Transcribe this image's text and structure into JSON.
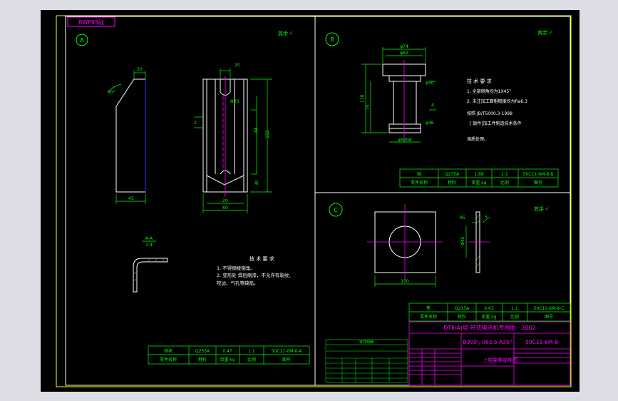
{
  "drawing": {
    "code_box": "8WPII3战",
    "views": [
      "A",
      "B",
      "C"
    ],
    "roughness": "其余 √",
    "view_a": {
      "dim_top": "20",
      "dim_angle": "60°",
      "dim_w1": "20",
      "dim_w2": "20",
      "dim_w3": "60",
      "dim_hole": "Φ25",
      "dim_h1": "88",
      "dim_h2": "30",
      "dim_h3": "152",
      "dim_bottom": "45",
      "dim_side": "2",
      "section_label": "A-A",
      "section_scale": "1:4",
      "notes_title": "技 术 要 求",
      "notes": [
        "1. 不得倒棱倒角。",
        "2. 变形处 焊后刷漆，不允许有裂纹、",
        "   咬边、气孔等缺陷。"
      ]
    },
    "view_b": {
      "dim_top": "φ74",
      "dim_a": "φ62",
      "dim_b": "φ50",
      "dim_c": "φ46",
      "dim_left": "118",
      "dim_mid": "75",
      "dim_bot": "φ50h6",
      "dim_side": "4",
      "notes_title": "技 术 要 求",
      "notes": [
        "1. 全部倒角均为1X45°",
        "2. 未注加工面粗糙度均为Ra6.3",
        "   按照 JB/T5000.3-1998",
        "[ 锻件]加工件制造技术条件",
        "   调质处理。"
      ],
      "table": {
        "row1": [
          "轴",
          "Q235A",
          "1.88",
          "1:1",
          "50C11-6M-8-B"
        ],
        "row2": [
          "零件名称",
          "材料",
          "单重 kg",
          "比例",
          "图号"
        ]
      }
    },
    "view_c": {
      "dim_width": "100",
      "dim_side": "5",
      "dim_hole": "Φ45",
      "dim_r": "R5",
      "table": {
        "row1": [
          "垫",
          "Q235A",
          "0.63",
          "1:1",
          "50C11-6M-8-C"
        ],
        "row2": [
          "零件名称",
          "材料",
          "单重 kg",
          "比例",
          "图号"
        ]
      }
    },
    "title_block": {
      "title": "DTⅡ(A)型 带式输送机专用图 - 2002",
      "spec": "B300 , 063.5 A35°",
      "drawing_no": "50C11-6M-8",
      "part_name": "上辊架零部件图"
    },
    "view_a_table": {
      "row1": [
        "挡块",
        "Q235A",
        "0.47",
        "1:1",
        "50C11-6M-8-A"
      ],
      "row2": [
        "零件名称",
        "材料",
        "单重 kg",
        "比例",
        "图号"
      ]
    },
    "small_table_title": "零件明细"
  },
  "colors": {
    "border": "#ffff00",
    "line": "#ffffff",
    "dimension": "#00ff00",
    "centerline": "#ff00ff",
    "hidden": "#3333ff",
    "background": "#000000",
    "outer": "#dcdde5"
  }
}
